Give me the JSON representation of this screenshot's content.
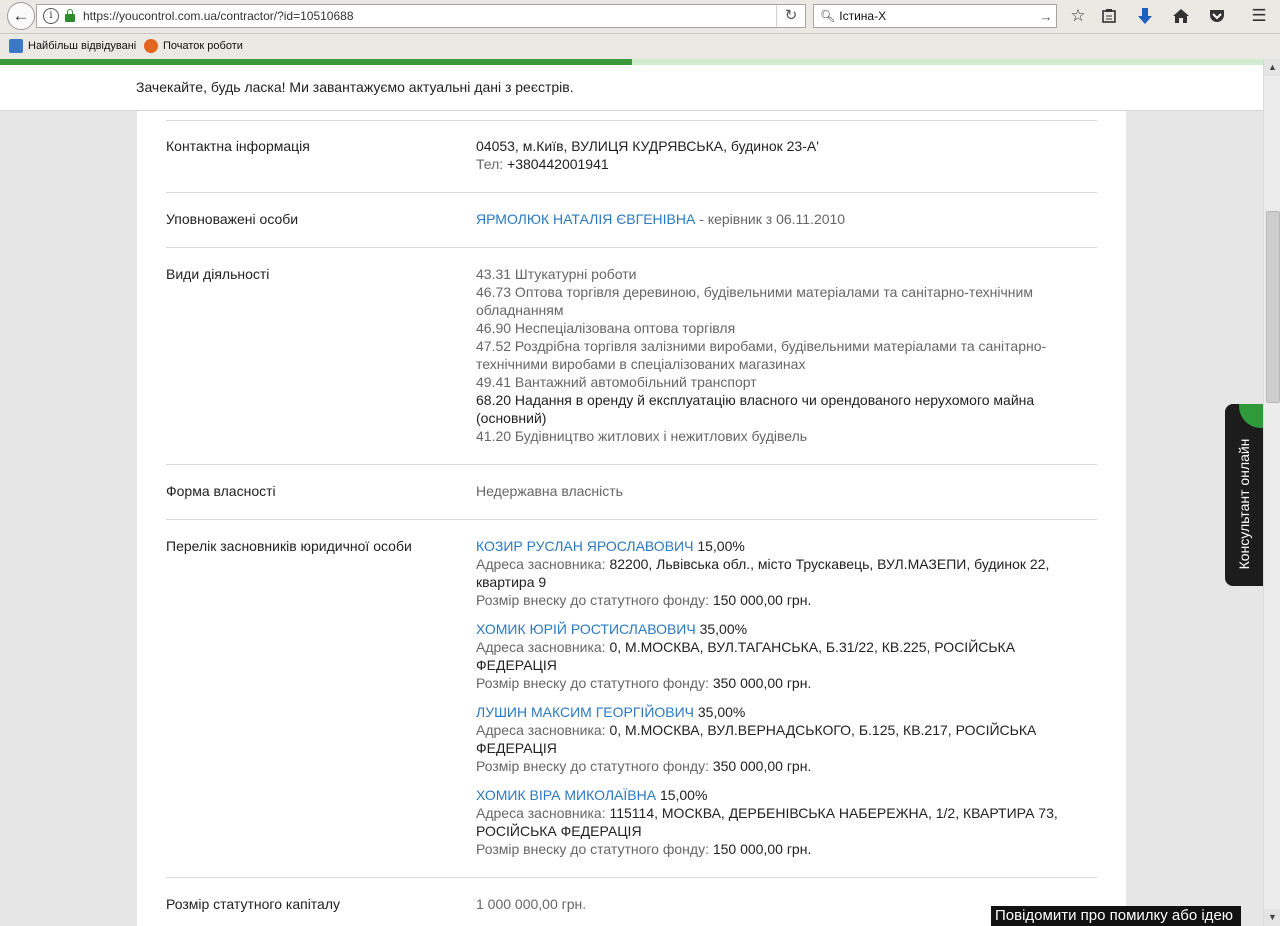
{
  "browser": {
    "url": "https://youcontrol.com.ua/contractor/?id=10510688",
    "search_text": "Істина-Х",
    "bookmarks": [
      "Найбільш відвідувані",
      "Початок роботи"
    ],
    "page_load_fraction": 0.5
  },
  "notice": "Зачекайте, будь ласка! Ми завантажуємо актуальні дані з реєстрів.",
  "contact": {
    "label": "Контактна інформація",
    "address": "04053, м.Київ, ВУЛИЦЯ КУДРЯВСЬКА, будинок 23-А'",
    "phone_label": "Тел:",
    "phone": "+380442001941"
  },
  "authorized": {
    "label": "Уповноважені особи",
    "person": "ЯРМОЛЮК НАТАЛІЯ ЄВГЕНІВНА",
    "role": " - керівник з 06.11.2010"
  },
  "activities": {
    "label": "Види діяльності",
    "items": [
      {
        "text": "43.31 Штукатурні роботи",
        "main": false
      },
      {
        "text": "46.73 Оптова торгівля деревиною, будівельними матеріалами та санітарно-технічним обладнанням",
        "main": false
      },
      {
        "text": "46.90 Неспеціалізована оптова торгівля",
        "main": false
      },
      {
        "text": "47.52 Роздрібна торгівля залізними виробами, будівельними матеріалами та санітарно-технічними виробами в спеціалізованих магазинах",
        "main": false
      },
      {
        "text": "49.41 Вантажний автомобільний транспорт",
        "main": false
      },
      {
        "text": "68.20 Надання в оренду й експлуатацію власного чи орендованого нерухомого майна (основний)",
        "main": true
      },
      {
        "text": "41.20 Будівництво житлових і нежитлових будівель",
        "main": false
      }
    ]
  },
  "ownership": {
    "label": "Форма власності",
    "value": "Недержавна власність"
  },
  "founders": {
    "label": "Перелік засновників юридичної особи",
    "address_label": "Адреса засновника:",
    "contribution_label": "Розмір внеску до статутного фонду:",
    "items": [
      {
        "name": "КОЗИР РУСЛАН ЯРОСЛАВОВИЧ",
        "share": "15,00%",
        "address": "82200, Львівська обл., місто Трускавець, ВУЛ.МАЗЕПИ, будинок 22, квартира 9",
        "contribution": "150 000,00 грн."
      },
      {
        "name": "ХОМИК ЮРІЙ РОСТИСЛАВОВИЧ",
        "share": "35,00%",
        "address": "0, М.МОСКВА, ВУЛ.ТАГАНСЬКА, Б.31/22, КВ.225, РОСІЙСЬКА ФЕДЕРАЦІЯ",
        "contribution": "350 000,00 грн."
      },
      {
        "name": "ЛУШИН МАКСИМ ГЕОРГІЙОВИЧ",
        "share": "35,00%",
        "address": "0, М.МОСКВА, ВУЛ.ВЕРНАДСЬКОГО, Б.125, КВ.217, РОСІЙСЬКА ФЕДЕРАЦІЯ",
        "contribution": "350 000,00 грн."
      },
      {
        "name": "ХОМИК ВІРА МИКОЛАЇВНА",
        "share": "15,00%",
        "address": "115114, МОСКВА, ДЕРБЕНІВСЬКА НАБЕРЕЖНА, 1/2, КВАРТИРА 73, РОСІЙСЬКА ФЕДЕРАЦІЯ",
        "contribution": "150 000,00 грн."
      }
    ]
  },
  "capital": {
    "label": "Розмір статутного капіталу",
    "value": "1 000 000,00 грн."
  },
  "widgets": {
    "consultant": "Консультант онлайн",
    "report_error": "Повідомити про помилку або ідею"
  },
  "colors": {
    "link": "#2b79c2",
    "accent_green": "#3a9a3a"
  }
}
